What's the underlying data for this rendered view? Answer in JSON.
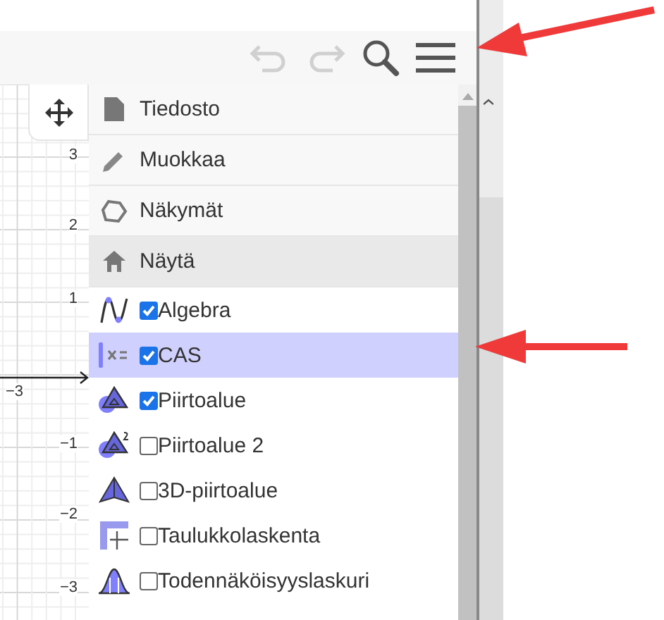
{
  "toolbar": {
    "buttons": [
      {
        "kind": "undo",
        "disabled": true
      },
      {
        "kind": "redo",
        "disabled": true
      },
      {
        "kind": "search",
        "disabled": false
      },
      {
        "kind": "menu",
        "disabled": false
      }
    ]
  },
  "graph": {
    "y_labels": [
      "3",
      "2",
      "1",
      "−1",
      "−2",
      "−3"
    ],
    "x_labels": [
      "−3"
    ]
  },
  "menu": {
    "sections": [
      {
        "kind": "file",
        "label": "Tiedosto",
        "selected": false
      },
      {
        "kind": "edit",
        "label": "Muokkaa",
        "selected": false
      },
      {
        "kind": "perspectives",
        "label": "Näkymät",
        "selected": false
      },
      {
        "kind": "view",
        "label": "Näytä",
        "selected": true
      }
    ],
    "views": [
      {
        "kind": "algebra",
        "label": "Algebra",
        "checked": true,
        "selected": false
      },
      {
        "kind": "cas",
        "label": "CAS",
        "checked": true,
        "selected": true
      },
      {
        "kind": "graphics",
        "label": "Piirtoalue",
        "checked": true,
        "selected": false
      },
      {
        "kind": "graphics2",
        "label": "Piirtoalue 2",
        "checked": false,
        "selected": false
      },
      {
        "kind": "graphics3d",
        "label": "3D-piirtoalue",
        "checked": false,
        "selected": false
      },
      {
        "kind": "spreadsheet",
        "label": "Taulukkolaskenta",
        "checked": false,
        "selected": false
      },
      {
        "kind": "probability",
        "label": "Todennäköisyyslaskuri",
        "checked": false,
        "selected": false
      }
    ]
  }
}
